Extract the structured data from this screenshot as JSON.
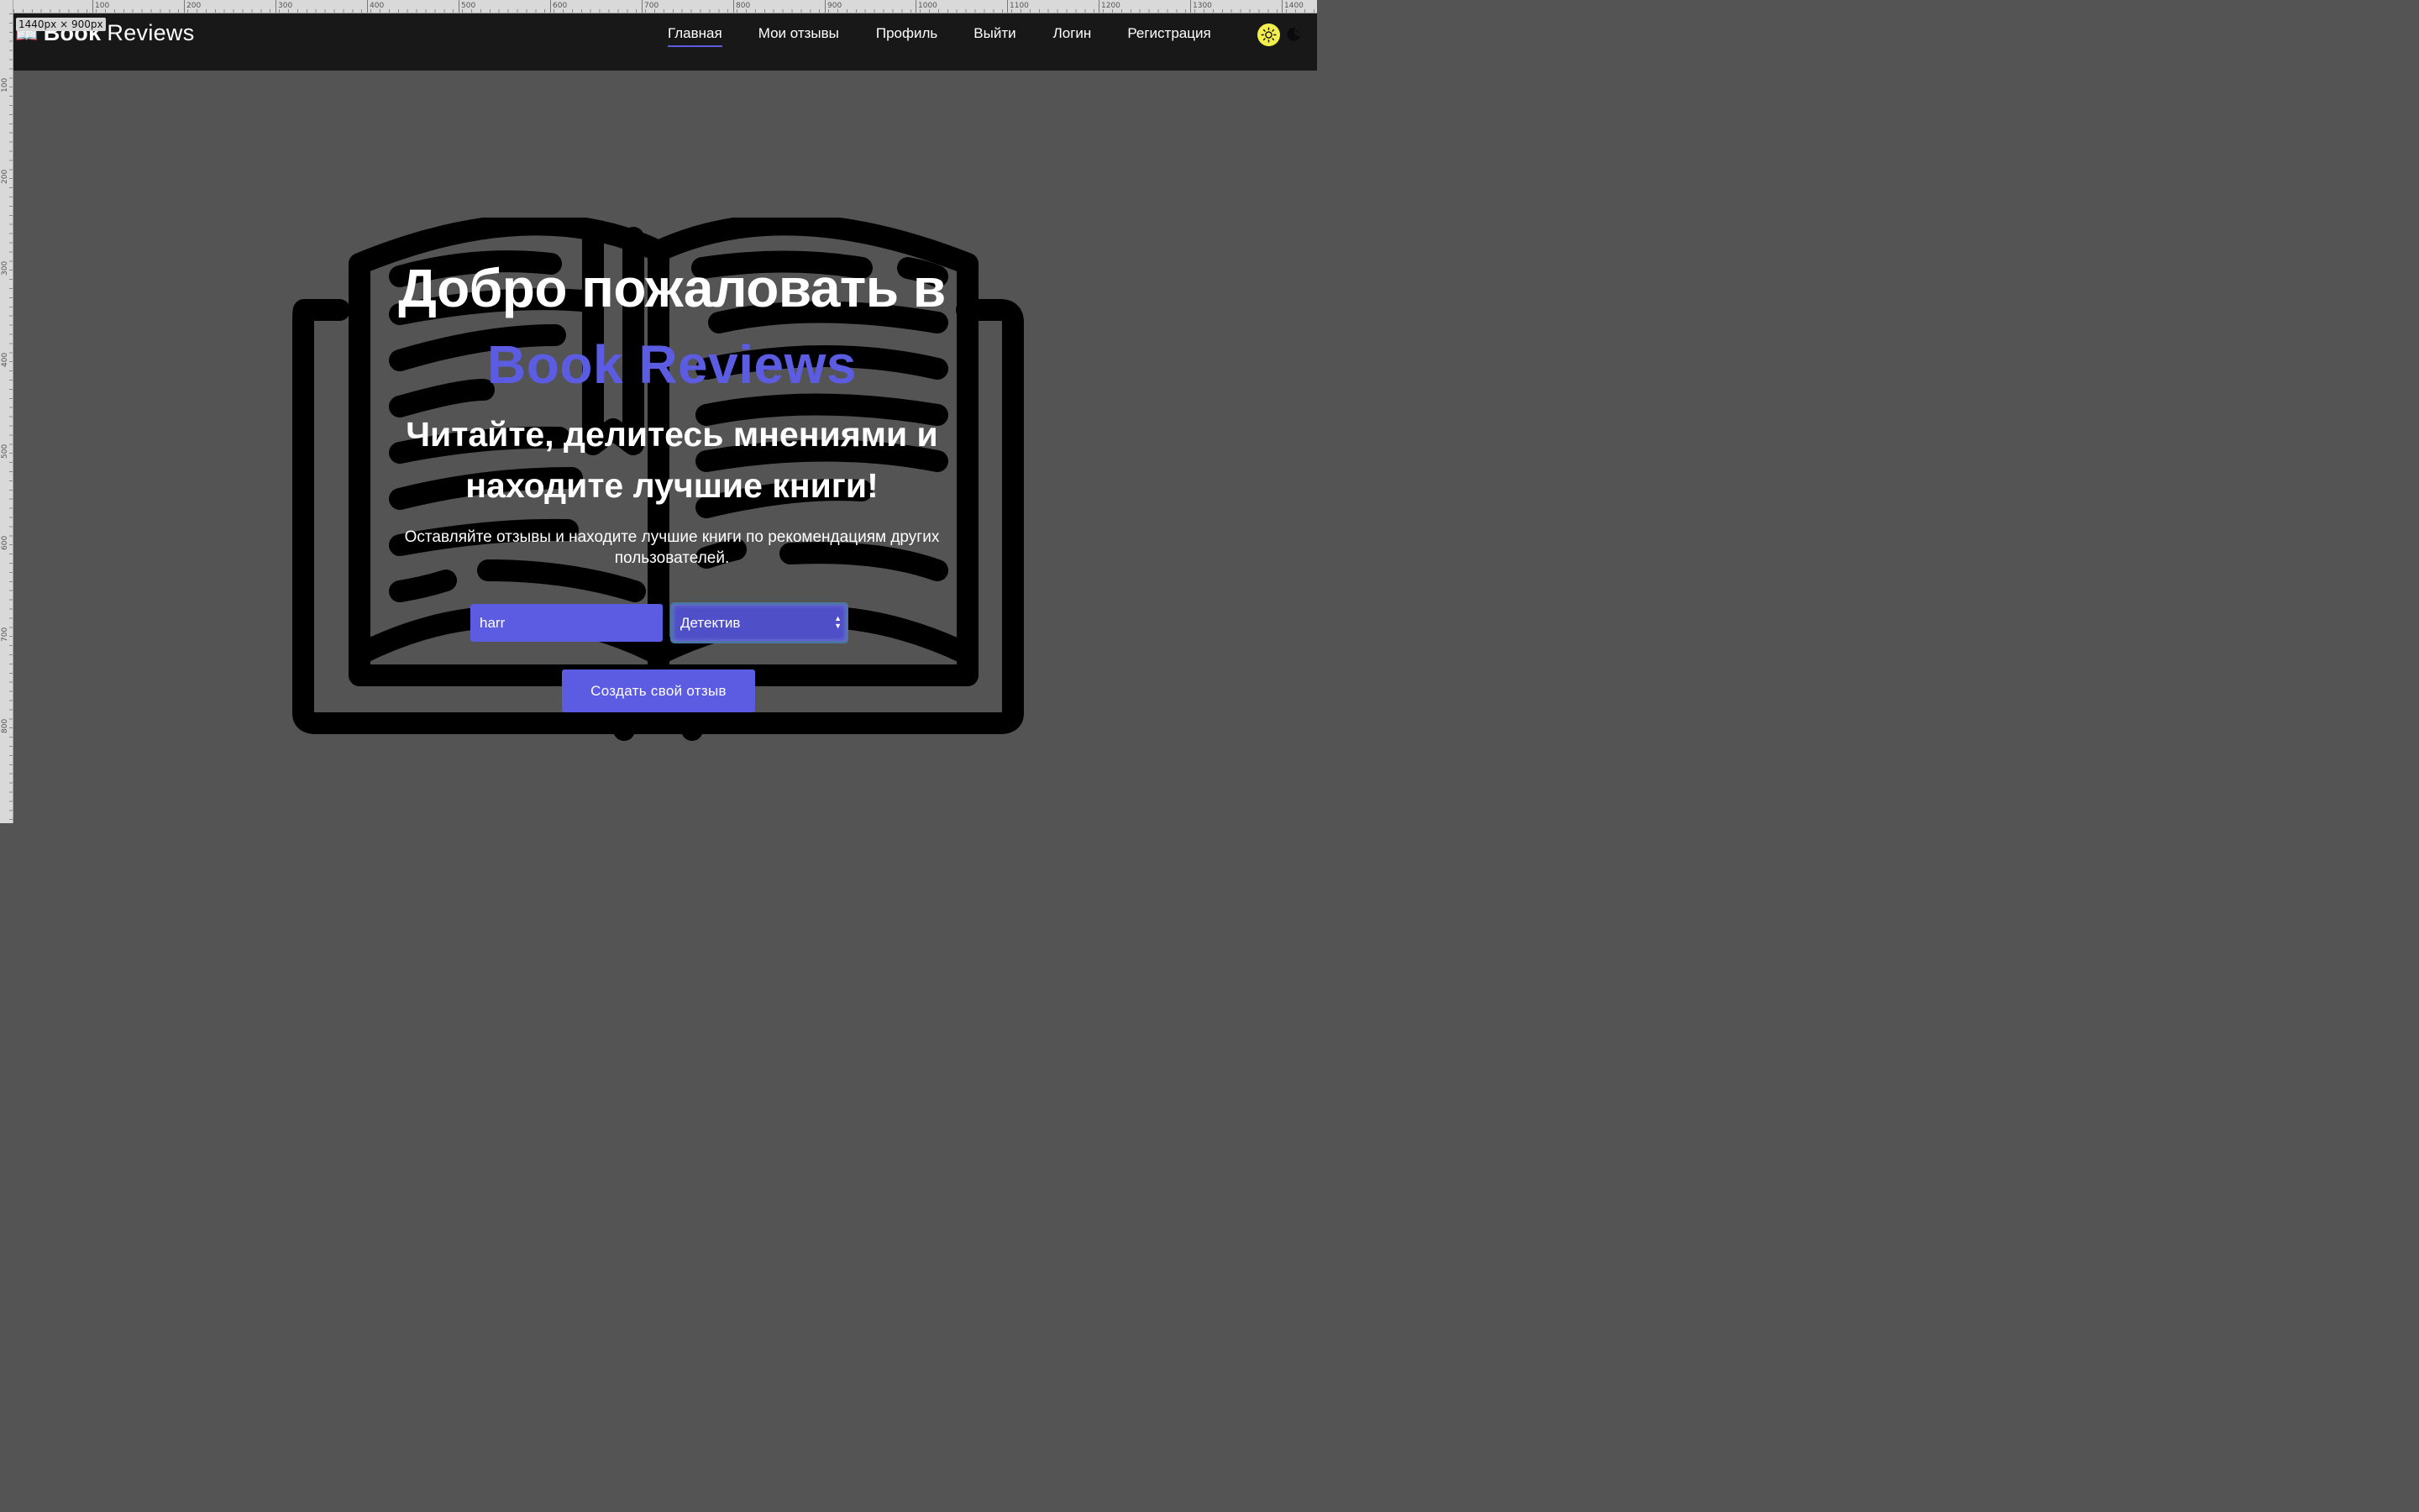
{
  "overlay": {
    "size_badge": "1440px × 900px",
    "ruler_top_labels": [
      "100",
      "200",
      "300",
      "400",
      "500",
      "600",
      "700",
      "800",
      "900",
      "1000",
      "1100",
      "1200",
      "1300",
      "1400"
    ],
    "ruler_left_labels": [
      "100",
      "200",
      "300",
      "400",
      "500",
      "600",
      "700",
      "800"
    ]
  },
  "brand": {
    "icon": "📖",
    "bold": "Book",
    "regular": "Reviews"
  },
  "nav": {
    "items": [
      {
        "label": "Главная",
        "active": true
      },
      {
        "label": "Мои отзывы",
        "active": false
      },
      {
        "label": "Профиль",
        "active": false
      },
      {
        "label": "Выйти",
        "active": false
      },
      {
        "label": "Логин",
        "active": false
      },
      {
        "label": "Регистрация",
        "active": false
      }
    ]
  },
  "theme": {
    "light_icon": "sun-icon",
    "dark_icon": "moon-icon"
  },
  "hero": {
    "title_line1": "Добро пожаловать в",
    "title_line2": "Book Reviews",
    "subtitle": "Читайте, делитесь мнениями и находите лучшие книги!",
    "description": "Оставляйте отзывы и находите лучшие книги по рекомендациям других пользователей.",
    "search_value": "harr",
    "genre_selected": "Детектив",
    "cta_label": "Создать свой отзыв"
  },
  "colors": {
    "accent": "#5b5ce2",
    "background": "#545454",
    "navbar": "#181818",
    "sun": "#f4ee4c"
  }
}
